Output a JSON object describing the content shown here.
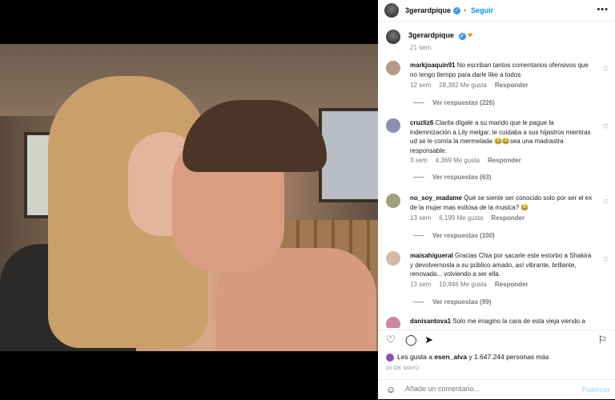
{
  "post": {
    "username": "3gerardpique",
    "follow_label": "Seguir",
    "caption_username": "3gerardpique",
    "caption_time": "21 sem",
    "more_icon": "more-dots-icon"
  },
  "comments": [
    {
      "user": "markjoaquin91",
      "text": "No escriban tantos comentarios ofensivos que no tengo tiempo para darle like a todos",
      "time": "12 sem",
      "likes": "28,382 Me gusta",
      "reply": "Responder",
      "view_replies": "Ver respuestas (226)",
      "avatar_color": "#b59a85"
    },
    {
      "user": "cruzliz6",
      "text": "Clarita dígale a su marido que le pague la indemnización a Lily melgar, le cuidaba a sus hijastros mientras ud se le comía la mermelada 😂😂sea una madrastra responsable.",
      "time": "3 sem",
      "likes": "4,369 Me gusta",
      "reply": "Responder",
      "view_replies": "Ver respuestas (63)",
      "avatar_color": "#8a8fb5"
    },
    {
      "user": "no_soy_madame",
      "text": "Qué se siente ser conocido solo por ser el ex de la mujer mas exitosa de la musica? 😂",
      "time": "13 sem",
      "likes": "6,199 Me gusta",
      "reply": "Responder",
      "view_replies": "Ver respuestas (100)",
      "avatar_color": "#a0a07a"
    },
    {
      "user": "maisahigueral",
      "text": "Gracias Chia por sacarle este estorbo a Shakira y devolvernosla a su público amado, así vibrante, brillante, renovada... volviendo a ser ella.",
      "time": "13 sem",
      "likes": "10,846 Me gusta",
      "reply": "Responder",
      "view_replies": "Ver respuestas (99)",
      "avatar_color": "#d4b9a6"
    },
    {
      "user": "danisantova1",
      "text": "Solo me imagino la cara de esta vieja viendo a",
      "avatar_color": "#c98aa0"
    }
  ],
  "liked_by": {
    "prefix": "Les gusta a ",
    "user": "esen_alva",
    "suffix": " y 1.647.244 personas más"
  },
  "date": "20 DE MAYO",
  "add_comment": {
    "placeholder": "Añade un comentario...",
    "publish": "Publicar"
  },
  "colors": {
    "accent": "#0095f6",
    "verified": "#3897f0",
    "publish_disabled": "#b2dffc"
  }
}
